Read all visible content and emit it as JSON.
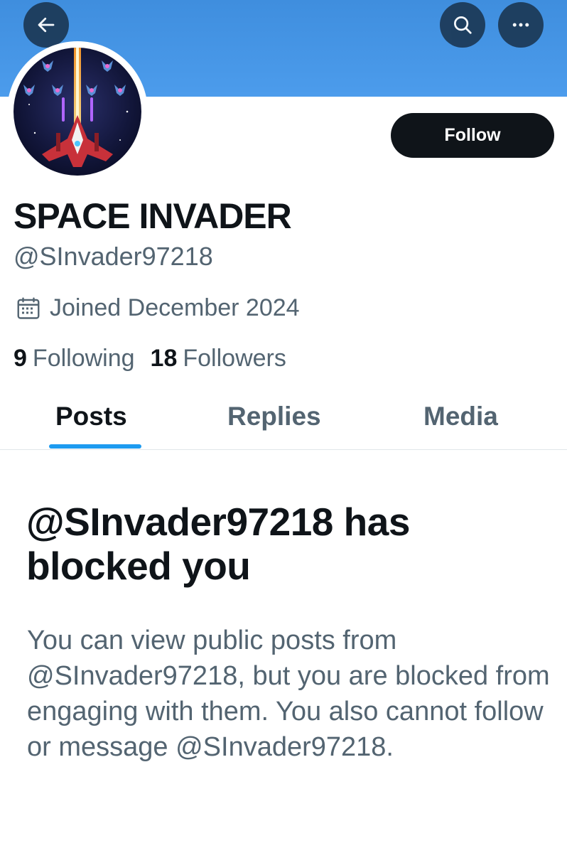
{
  "header": {
    "back_icon": "arrow-left-icon",
    "search_icon": "search-icon",
    "more_icon": "more-horizontal-icon",
    "banner_color": "#4a98e8"
  },
  "profile": {
    "display_name": "SPACE INVADER",
    "handle": "@SInvader97218",
    "joined": "Joined December 2024",
    "follow_label": "Follow",
    "following_count": "9",
    "following_label": "Following",
    "followers_count": "18",
    "followers_label": "Followers"
  },
  "tabs": [
    {
      "label": "Posts",
      "active": true
    },
    {
      "label": "Replies",
      "active": false
    },
    {
      "label": "Media",
      "active": false
    }
  ],
  "blocked": {
    "title": "@SInvader97218 has blocked you",
    "body": "You can view public posts from @SInvader97218, but you are blocked from engaging with them. You also cannot follow or message @SInvader97218."
  }
}
